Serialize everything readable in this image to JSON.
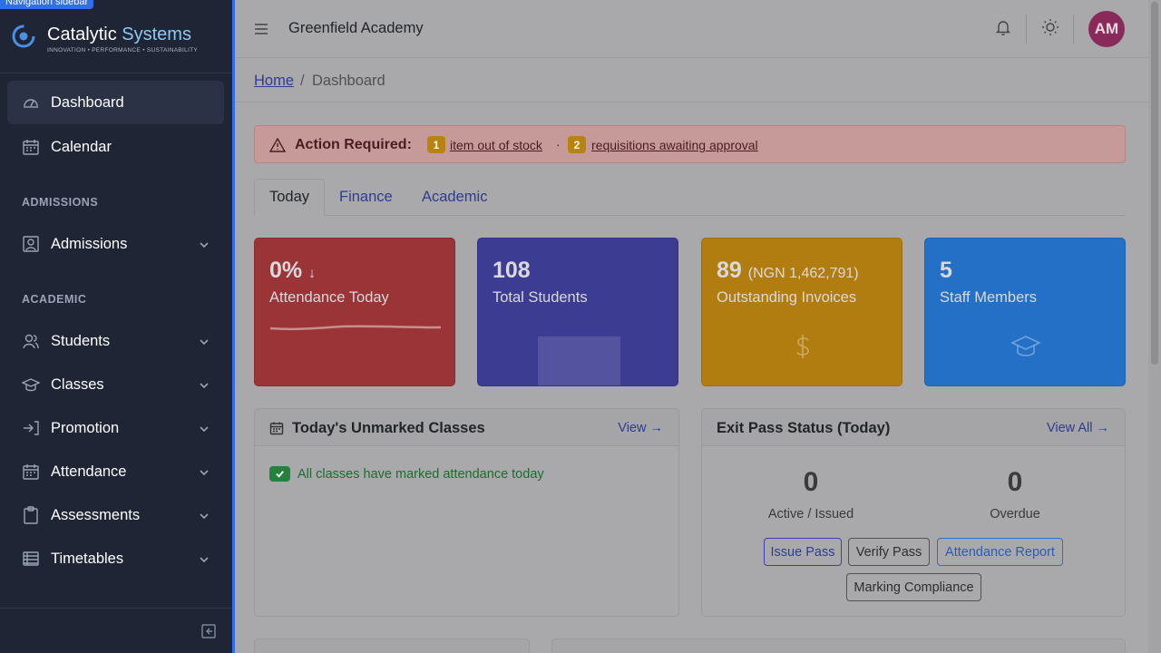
{
  "skip_link": "Navigation sidebar",
  "brand": {
    "name_a": "Catalytic",
    "name_b": "Systems",
    "tagline": "INNOVATION • PERFORMANCE • SUSTAINABILITY"
  },
  "sidebar": {
    "items": [
      {
        "label": "Dashboard",
        "icon": "dashboard-icon",
        "active": true
      },
      {
        "label": "Calendar",
        "icon": "calendar-icon"
      }
    ],
    "sections": [
      {
        "label": "ADMISSIONS",
        "items": [
          {
            "label": "Admissions",
            "icon": "admissions-icon"
          }
        ]
      },
      {
        "label": "ACADEMIC",
        "items": [
          {
            "label": "Students",
            "icon": "students-icon"
          },
          {
            "label": "Classes",
            "icon": "classes-icon"
          },
          {
            "label": "Promotion",
            "icon": "promotion-icon"
          },
          {
            "label": "Attendance",
            "icon": "attendance-icon"
          },
          {
            "label": "Assessments",
            "icon": "assessments-icon"
          },
          {
            "label": "Timetables",
            "icon": "timetables-icon"
          }
        ]
      }
    ]
  },
  "topbar": {
    "school_name": "Greenfield Academy",
    "avatar_initials": "AM"
  },
  "breadcrumb": {
    "home": "Home",
    "separator": "/",
    "current": "Dashboard"
  },
  "alert": {
    "title": "Action Required:",
    "items": [
      {
        "count": "1",
        "text": "item out of stock"
      },
      {
        "count": "2",
        "text": "requisitions awaiting approval"
      }
    ],
    "separator": "·"
  },
  "tabs": [
    {
      "label": "Today",
      "active": true
    },
    {
      "label": "Finance"
    },
    {
      "label": "Academic"
    }
  ],
  "stats": [
    {
      "value": "0%",
      "trend": "↓",
      "label": "Attendance Today",
      "color": "#9b3436"
    },
    {
      "value": "108",
      "label": "Total Students",
      "color": "#3d3c93"
    },
    {
      "value": "89",
      "sub": "(NGN 1,462,791)",
      "label": "Outstanding Invoices",
      "color": "#b27d10",
      "icon": "dollar-icon"
    },
    {
      "value": "5",
      "label": "Staff Members",
      "color": "#2470c6",
      "icon": "graduation-cap-icon"
    }
  ],
  "unmarked": {
    "title": "Today's Unmarked Classes",
    "link": "View →",
    "message": "All classes have marked attendance today"
  },
  "exit_pass": {
    "title": "Exit Pass Status (Today)",
    "link": "View All →",
    "active_count": "0",
    "active_label": "Active / Issued",
    "overdue_count": "0",
    "overdue_label": "Overdue",
    "buttons": [
      "Issue Pass",
      "Verify Pass",
      "Attendance Report",
      "Marking Compliance"
    ]
  },
  "colors": {
    "sidebar_bg": "#1f2535",
    "accent": "#2f6fea",
    "brand_light": "#8fc8f2"
  }
}
